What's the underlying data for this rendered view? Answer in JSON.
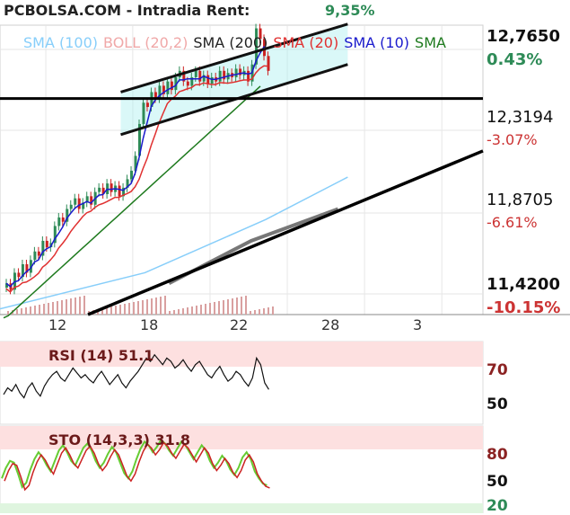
{
  "header": {
    "title": "PCBOLSA.COM - Intradia  Rent:",
    "rent": "9,35%"
  },
  "legend": {
    "sma100": "SMA (100)",
    "boll": "BOLL (20,2)",
    "sma200": "SMA (200)",
    "sma20": "SMA (20)",
    "sma10": "SMA (10)",
    "sma": "SMA"
  },
  "colors": {
    "sma100": "#87cefa",
    "boll": "#f4b6b6",
    "sma200": "#222222",
    "sma20": "#e03030",
    "sma10": "#1a1acc",
    "sma": "#1e7a1e",
    "up": "#2e8b57",
    "down": "#cc2222",
    "channel": "#aef0f0"
  },
  "price_axis": [
    {
      "price": "12,7650",
      "pct": "0.43%",
      "pct_color": "#2e8b57",
      "bold": true
    },
    {
      "price": "12,3194",
      "pct": "-3.07%",
      "pct_color": "#cc3333",
      "bold": false
    },
    {
      "price": "11,8705",
      "pct": "-6.61%",
      "pct_color": "#cc3333",
      "bold": false
    },
    {
      "price": "11,4200",
      "pct": "-10.15%",
      "pct_color": "#cc3333",
      "bold": true
    }
  ],
  "x_labels": [
    "12",
    "18",
    "22",
    "28",
    "3"
  ],
  "rsi": {
    "label": "RSI (14) 51.1",
    "levels": [
      "70",
      "50"
    ]
  },
  "sto": {
    "label": "STO (14,3,3) 31.8",
    "levels": [
      "80",
      "50",
      "20"
    ]
  },
  "chart_data": {
    "type": "line",
    "ylim": [
      11.42,
      12.765
    ],
    "close": [
      11.55,
      11.52,
      11.6,
      11.58,
      11.64,
      11.6,
      11.66,
      11.7,
      11.68,
      11.75,
      11.72,
      11.74,
      11.82,
      11.86,
      11.84,
      11.9,
      11.92,
      11.95,
      11.9,
      11.93,
      11.96,
      11.92,
      11.98,
      12.0,
      11.97,
      12.02,
      11.98,
      12.01,
      11.96,
      12.0,
      12.04,
      12.08,
      12.15,
      12.3,
      12.4,
      12.38,
      12.45,
      12.42,
      12.48,
      12.44,
      12.5,
      12.46,
      12.52,
      12.55,
      12.5,
      12.48,
      12.52,
      12.55,
      12.5,
      12.53,
      12.49,
      12.52,
      12.5,
      12.55,
      12.51,
      12.54,
      12.52,
      12.56,
      12.53,
      12.55,
      12.5,
      12.58,
      12.75,
      12.7,
      12.62,
      12.55
    ],
    "sma200": [
      11.43,
      11.44,
      11.46,
      11.48,
      11.5,
      11.52,
      11.54,
      11.56,
      11.58,
      11.6,
      11.62,
      11.64,
      11.66,
      11.68,
      11.7,
      11.72,
      11.74,
      11.76,
      11.78,
      11.8,
      11.82,
      11.84,
      11.86,
      11.88,
      11.9,
      11.92,
      11.94,
      11.96,
      11.98,
      12.0,
      12.02,
      12.04,
      12.06,
      12.08,
      12.1,
      12.12,
      12.14,
      12.16,
      12.18,
      12.2,
      12.22,
      12.24,
      12.26,
      12.28,
      12.3,
      12.32,
      12.34,
      12.36,
      12.38,
      12.4,
      12.42,
      12.44,
      12.46,
      12.48,
      12.5,
      12.52
    ],
    "sma100_xy": [
      [
        0.0,
        11.43
      ],
      [
        0.3,
        11.6
      ],
      [
        0.55,
        11.85
      ],
      [
        0.72,
        12.05
      ]
    ],
    "sma_grey_xy": [
      [
        0.35,
        11.55
      ],
      [
        0.52,
        11.75
      ],
      [
        0.7,
        11.9
      ]
    ],
    "trend_support_xy": [
      [
        0.08,
        11.42
      ],
      [
        1.0,
        12.3
      ]
    ],
    "horizontal_line": 12.42,
    "channel_upper_xy": [
      [
        0.25,
        12.45
      ],
      [
        0.72,
        12.77
      ]
    ],
    "channel_lower_xy": [
      [
        0.25,
        12.25
      ],
      [
        0.72,
        12.58
      ]
    ],
    "rsi_values": [
      48,
      52,
      50,
      54,
      49,
      46,
      52,
      55,
      50,
      47,
      53,
      57,
      60,
      62,
      58,
      56,
      60,
      64,
      61,
      58,
      60,
      57,
      55,
      59,
      62,
      58,
      54,
      57,
      60,
      55,
      52,
      56,
      59,
      62,
      66,
      70,
      68,
      72,
      69,
      66,
      70,
      68,
      64,
      66,
      69,
      65,
      62,
      66,
      68,
      64,
      60,
      58,
      62,
      65,
      60,
      56,
      58,
      62,
      60,
      56,
      53,
      58,
      70,
      66,
      55,
      51
    ],
    "sto_values": [
      40,
      52,
      60,
      58,
      45,
      30,
      35,
      50,
      62,
      70,
      64,
      55,
      48,
      60,
      72,
      78,
      70,
      60,
      55,
      65,
      75,
      80,
      72,
      60,
      52,
      58,
      68,
      76,
      70,
      58,
      46,
      40,
      48,
      62,
      74,
      82,
      78,
      70,
      76,
      84,
      80,
      72,
      66,
      74,
      82,
      78,
      70,
      62,
      70,
      78,
      72,
      60,
      52,
      58,
      66,
      60,
      50,
      44,
      52,
      64,
      70,
      62,
      48,
      40,
      34,
      32
    ]
  }
}
